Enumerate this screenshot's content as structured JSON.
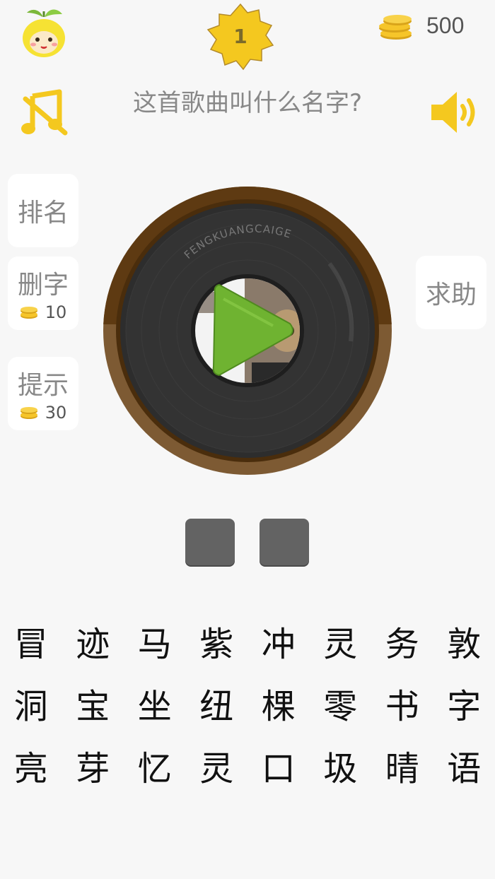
{
  "level": {
    "number": "1"
  },
  "coins": {
    "count": "500"
  },
  "question": {
    "text": "这首歌曲叫什么名字?"
  },
  "side": {
    "rank_label": "排名",
    "delete_label": "删字",
    "delete_cost": "10",
    "hint_label": "提示",
    "hint_cost": "30",
    "help_label": "求助"
  },
  "record": {
    "brand": "FENGKUANGCAIGE"
  },
  "answer": {
    "slots": 2
  },
  "characters": [
    "冒",
    "迹",
    "马",
    "紫",
    "冲",
    "灵",
    "务",
    "敦",
    "洞",
    "宝",
    "坐",
    "纽",
    "棵",
    "零",
    "书",
    "字",
    "亮",
    "芽",
    "忆",
    "灵",
    "口",
    "圾",
    "晴",
    "语"
  ],
  "colors": {
    "accent_yellow": "#f4c81f",
    "slot_gray": "#636363",
    "record_brown": "#6a4317",
    "play_green": "#6fb331"
  },
  "icons": {
    "avatar": "fruit-mascot-icon",
    "level": "star-badge-icon",
    "coins": "coin-stack-icon",
    "music": "music-off-icon",
    "sound": "speaker-icon",
    "play": "play-icon"
  }
}
